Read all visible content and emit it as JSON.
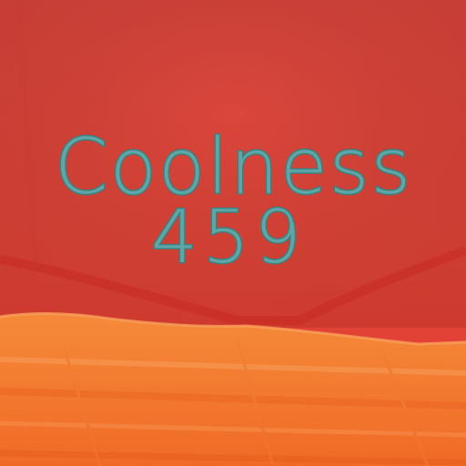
{
  "scene": {
    "score_label": "Coolness",
    "score_value": "459",
    "colors": {
      "wall_top": "#d8463d",
      "wall_mid": "#e04538",
      "wall_bottom": "#e8382e",
      "floor_near": "#f06a25",
      "floor_far": "#f58a3a",
      "floor_highlight": "#f9a05a",
      "scribble": "#5fa7a6",
      "scribble_shadow": "#3e7f80"
    }
  }
}
